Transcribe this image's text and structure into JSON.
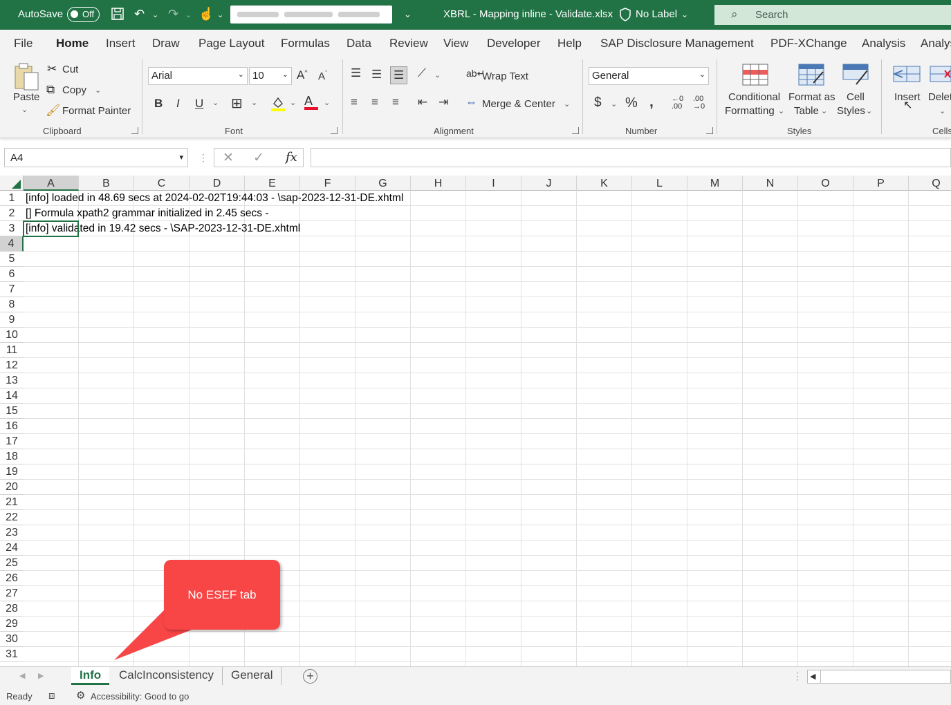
{
  "title_bar": {
    "autosave_label": "AutoSave",
    "autosave_state": "Off",
    "file_name": "XBRL - Mapping inline - Validate.xlsx",
    "sensitivity": "No Label",
    "search_placeholder": "Search"
  },
  "menu": {
    "tabs": [
      "File",
      "Home",
      "Insert",
      "Draw",
      "Page Layout",
      "Formulas",
      "Data",
      "Review",
      "View",
      "Developer",
      "Help",
      "SAP Disclosure Management",
      "PDF-XChange",
      "Analysis",
      "Analys"
    ],
    "active": "Home"
  },
  "ribbon": {
    "clipboard": {
      "paste": "Paste",
      "cut": "Cut",
      "copy": "Copy",
      "format_painter": "Format Painter",
      "label": "Clipboard"
    },
    "font": {
      "name": "Arial",
      "size": "10",
      "label": "Font"
    },
    "alignment": {
      "wrap_text": "Wrap Text",
      "merge_center": "Merge & Center",
      "label": "Alignment"
    },
    "number": {
      "format": "General",
      "label": "Number"
    },
    "styles": {
      "conditional_1": "Conditional",
      "conditional_2": "Formatting",
      "format_table_1": "Format as",
      "format_table_2": "Table",
      "cell_styles_1": "Cell",
      "cell_styles_2": "Styles",
      "label": "Styles"
    },
    "cells": {
      "insert": "Insert",
      "delete": "Delet",
      "label": "Cells"
    }
  },
  "formula_bar": {
    "name_box": "A4",
    "fx": "fx",
    "formula": ""
  },
  "grid": {
    "columns": [
      "A",
      "B",
      "C",
      "D",
      "E",
      "F",
      "G",
      "H",
      "I",
      "J",
      "K",
      "L",
      "M",
      "N",
      "O",
      "P",
      "Q"
    ],
    "rows": [
      "1",
      "2",
      "3",
      "4",
      "5",
      "6",
      "7",
      "8",
      "9",
      "10",
      "11",
      "12",
      "13",
      "14",
      "15",
      "16",
      "17",
      "18",
      "19",
      "20",
      "21",
      "22",
      "23",
      "24",
      "25",
      "26",
      "27",
      "28",
      "29",
      "30",
      "31"
    ],
    "cells": {
      "A1": "[info] loaded in 48.69 secs at 2024-02-02T19:44:03 - \\sap-2023-12-31-DE.xhtml",
      "A2": "[] Formula xpath2 grammar initialized in 2.45 secs -",
      "A3": "[info] validated in 19.42 secs - \\SAP-2023-12-31-DE.xhtml"
    },
    "selected_cell": "A4"
  },
  "callout": {
    "text": "No ESEF tab",
    "color": "#f84545"
  },
  "sheets": {
    "tabs": [
      "Info",
      "CalcInconsistency",
      "General"
    ],
    "active": "Info"
  },
  "status_bar": {
    "ready": "Ready",
    "accessibility": "Accessibility: Good to go"
  },
  "colors": {
    "accent": "#217346"
  }
}
